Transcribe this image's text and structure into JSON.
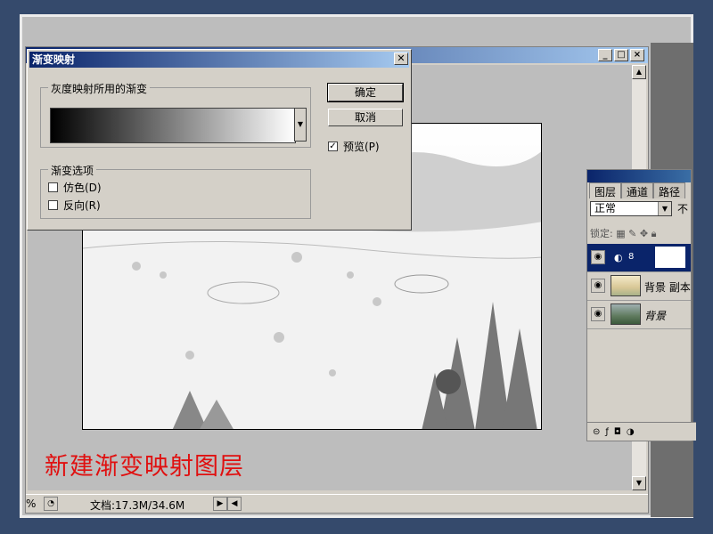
{
  "document": {
    "status_text": "文档:17.3M/34.6M",
    "zoom_prefix": "%"
  },
  "dialog": {
    "title": "渐变映射",
    "close_label": "✕",
    "gradient_group_label": "灰度映射所用的渐变",
    "options_group_label": "渐变选项",
    "dither_label": "仿色(D)",
    "reverse_label": "反向(R)",
    "ok_label": "确定",
    "cancel_label": "取消",
    "preview_label": "预览(P)",
    "preview_checked": true,
    "dither_checked": false,
    "reverse_checked": false
  },
  "layers_panel": {
    "tabs": [
      "图层",
      "通道",
      "路径"
    ],
    "blend_mode": "正常",
    "opacity_label": "不",
    "lock_label": "锁定:",
    "layers": [
      {
        "name": "",
        "selected": true,
        "kind": "adjustment"
      },
      {
        "name": "背景 副本",
        "selected": false,
        "kind": "image"
      },
      {
        "name": "背景",
        "selected": false,
        "kind": "image"
      }
    ]
  },
  "caption": "新建渐变映射图层",
  "colors": {
    "desktop": "#354a6c",
    "titlebar": "#0a246a",
    "caption": "#e01010"
  }
}
